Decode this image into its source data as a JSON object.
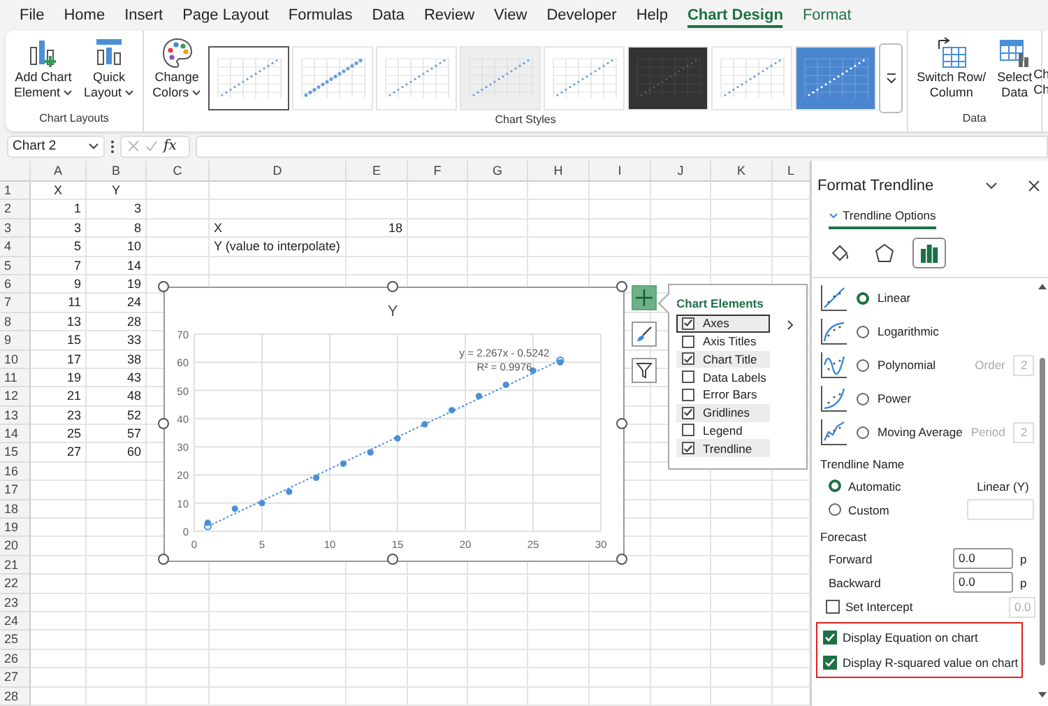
{
  "menu": {
    "items": [
      {
        "label": "File",
        "selected": false,
        "contextual": false
      },
      {
        "label": "Home",
        "selected": false,
        "contextual": false
      },
      {
        "label": "Insert",
        "selected": false,
        "contextual": false
      },
      {
        "label": "Page Layout",
        "selected": false,
        "contextual": false
      },
      {
        "label": "Formulas",
        "selected": false,
        "contextual": false
      },
      {
        "label": "Data",
        "selected": false,
        "contextual": false
      },
      {
        "label": "Review",
        "selected": false,
        "contextual": false
      },
      {
        "label": "View",
        "selected": false,
        "contextual": false
      },
      {
        "label": "Developer",
        "selected": false,
        "contextual": false
      },
      {
        "label": "Help",
        "selected": false,
        "contextual": false
      },
      {
        "label": "Chart Design",
        "selected": true,
        "contextual": true
      },
      {
        "label": "Format",
        "selected": false,
        "contextual": true
      }
    ]
  },
  "ribbon": {
    "groups": [
      {
        "label": "Chart Layouts",
        "buttons": [
          {
            "kind": "add-element",
            "lines": [
              "Add Chart",
              "Element"
            ],
            "dropdown": true
          },
          {
            "kind": "quick-layout",
            "lines": [
              "Quick",
              "Layout"
            ],
            "dropdown": true
          }
        ]
      },
      {
        "label": "Chart Styles",
        "buttons": [
          {
            "kind": "palette",
            "lines": [
              "Change",
              "Colors"
            ],
            "dropdown": true
          }
        ],
        "styles": [
          {
            "kind": "light",
            "selected": true
          },
          {
            "kind": "dots",
            "selected": false
          },
          {
            "kind": "light",
            "selected": false
          },
          {
            "kind": "grey",
            "selected": false
          },
          {
            "kind": "light",
            "selected": false
          },
          {
            "kind": "dark",
            "selected": false
          },
          {
            "kind": "light",
            "selected": false
          },
          {
            "kind": "blue",
            "selected": false
          }
        ]
      },
      {
        "label": "Data",
        "buttons": [
          {
            "kind": "switch",
            "lines": [
              "Switch Row/",
              "Column"
            ],
            "dropdown": false
          },
          {
            "kind": "select-data",
            "lines": [
              "Select",
              "Data"
            ],
            "dropdown": false
          }
        ]
      }
    ],
    "cut_button": {
      "lines": [
        "Ch",
        "Ch"
      ]
    }
  },
  "formula_bar": {
    "name_box": "Chart 2",
    "function_label": "fx"
  },
  "sheet": {
    "columns": [
      "A",
      "B",
      "C",
      "D",
      "E",
      "F",
      "G",
      "H",
      "I",
      "J",
      "K",
      "L"
    ],
    "rows": [
      {
        "header": "1",
        "kind": "labels",
        "a": "X",
        "b": "Y"
      },
      {
        "header": "2",
        "a": "1",
        "b": "3"
      },
      {
        "header": "3",
        "a": "3",
        "b": "8",
        "d": "X",
        "e": "18"
      },
      {
        "header": "4",
        "a": "5",
        "b": "10",
        "d": "Y (value to interpolate)"
      },
      {
        "header": "5",
        "a": "7",
        "b": "14"
      },
      {
        "header": "6",
        "a": "9",
        "b": "19"
      },
      {
        "header": "7",
        "a": "11",
        "b": "24"
      },
      {
        "header": "8",
        "a": "13",
        "b": "28"
      },
      {
        "header": "9",
        "a": "15",
        "b": "33"
      },
      {
        "header": "10",
        "a": "17",
        "b": "38"
      },
      {
        "header": "11",
        "a": "19",
        "b": "43"
      },
      {
        "header": "12",
        "a": "21",
        "b": "48"
      },
      {
        "header": "13",
        "a": "23",
        "b": "52"
      },
      {
        "header": "14",
        "a": "25",
        "b": "57"
      },
      {
        "header": "15",
        "a": "27",
        "b": "60"
      },
      {
        "header": "16"
      },
      {
        "header": "17"
      },
      {
        "header": "18"
      },
      {
        "header": "19"
      },
      {
        "header": "20"
      },
      {
        "header": "21"
      },
      {
        "header": "22"
      },
      {
        "header": "23"
      },
      {
        "header": "24"
      },
      {
        "header": "25"
      },
      {
        "header": "26"
      },
      {
        "header": "27"
      },
      {
        "header": "28"
      }
    ]
  },
  "chart": {
    "chart_data": {
      "type": "scatter",
      "title": "Y",
      "x": [
        1,
        3,
        5,
        7,
        9,
        11,
        13,
        15,
        17,
        19,
        21,
        23,
        25,
        27
      ],
      "grid": true,
      "series": [
        {
          "color": "#4a8fd8",
          "values": [
            3,
            8,
            10,
            14,
            19,
            24,
            28,
            33,
            38,
            43,
            48,
            52,
            57,
            60
          ]
        }
      ],
      "xlim": [
        0,
        30
      ],
      "ylim": [
        0,
        70
      ],
      "xticks": [
        0,
        5,
        10,
        15,
        20,
        25,
        30
      ],
      "yticks": [
        0,
        10,
        20,
        30,
        40,
        50,
        60,
        70
      ],
      "annotations": [
        "y = 2.267x - 0.5242",
        "R² = 0.9976"
      ]
    },
    "side_buttons": [
      {
        "kind": "add",
        "selected": true
      },
      {
        "kind": "brush",
        "selected": false
      },
      {
        "kind": "filter",
        "selected": false
      }
    ]
  },
  "chart_elements": {
    "title": "Chart Elements",
    "items": [
      {
        "label": "Axes",
        "checked": true,
        "hovered": true
      },
      {
        "label": "Axis Titles",
        "checked": false,
        "hovered": false
      },
      {
        "label": "Chart Title",
        "checked": true,
        "hovered": false
      },
      {
        "label": "Data Labels",
        "checked": false,
        "hovered": false
      },
      {
        "label": "Error Bars",
        "checked": false,
        "hovered": false
      },
      {
        "label": "Gridlines",
        "checked": true,
        "hovered": false
      },
      {
        "label": "Legend",
        "checked": false,
        "hovered": false
      },
      {
        "label": "Trendline",
        "checked": true,
        "hovered": false
      }
    ]
  },
  "panel": {
    "title": "Format Trendline",
    "section": "Trendline Options",
    "icon_tabs": [
      {
        "kind": "fill",
        "selected": false
      },
      {
        "kind": "effects",
        "selected": false
      },
      {
        "kind": "options",
        "selected": true
      }
    ],
    "types": [
      {
        "kind": "linear",
        "label": "Linear",
        "selected": true
      },
      {
        "kind": "log",
        "label": "Logarithmic",
        "selected": false
      },
      {
        "kind": "poly",
        "label": "Polynomial",
        "selected": false,
        "param_label": "Order",
        "param_value": "2"
      },
      {
        "kind": "power",
        "label": "Power",
        "selected": false
      },
      {
        "kind": "moving",
        "label": "Moving Average",
        "selected": false,
        "param_label": "Period",
        "param_value": "2"
      }
    ],
    "name_heading": "Trendline Name",
    "name_options": [
      {
        "kind": "automatic",
        "label": "Automatic",
        "selected": true,
        "value": "Linear (Y)"
      },
      {
        "kind": "custom",
        "label": "Custom",
        "selected": false
      }
    ],
    "forecast_heading": "Forecast",
    "forecast": [
      {
        "label": "Forward",
        "value": "0.0",
        "unit": "p"
      },
      {
        "label": "Backward",
        "value": "0.0",
        "unit": "p"
      }
    ],
    "intercept": {
      "label": "Set Intercept",
      "checked": false,
      "value": "0.0"
    },
    "display_highlighted": true,
    "display": [
      {
        "label": "Display Equation on chart",
        "checked": true
      },
      {
        "label": "Display R-squared value on chart",
        "checked": true
      }
    ]
  }
}
